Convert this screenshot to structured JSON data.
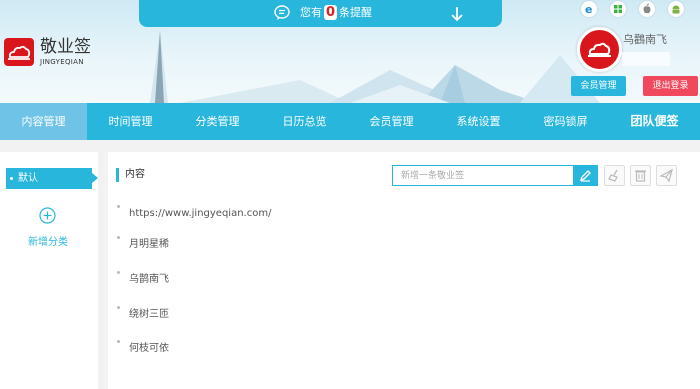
{
  "notice": {
    "prefix": "您有",
    "count": "0",
    "suffix": "条提醒"
  },
  "brand": {
    "title": "敬业签",
    "subtitle": "JINGYEQIAN"
  },
  "platform_icons": [
    "ie-icon",
    "windows-icon",
    "apple-icon",
    "android-icon"
  ],
  "user": {
    "name": "乌鸛南飞",
    "member_label": "会员管理",
    "logout_label": "退出登录"
  },
  "nav": {
    "items": [
      {
        "label": "内容管理"
      },
      {
        "label": "时间管理"
      },
      {
        "label": "分类管理"
      },
      {
        "label": "日历总览"
      },
      {
        "label": "会员管理"
      },
      {
        "label": "系统设置"
      },
      {
        "label": "密码锁屏"
      },
      {
        "label": "团队便签"
      }
    ]
  },
  "categories": {
    "default_label": "默认",
    "add_label": "新增分类"
  },
  "content": {
    "title": "内容",
    "new_placeholder": "新增一条敬业签",
    "notes": [
      {
        "text": "https://www.jingyeqian.com/"
      },
      {
        "text": "月明星稀"
      },
      {
        "text": "乌鹊南飞"
      },
      {
        "text": "绕树三匝"
      },
      {
        "text": "何枝可依"
      }
    ]
  },
  "colors": {
    "accent": "#29b6dc",
    "active_nav": "#6fc3e6",
    "logout": "#f0495d",
    "brand_red": "#d9161c"
  }
}
